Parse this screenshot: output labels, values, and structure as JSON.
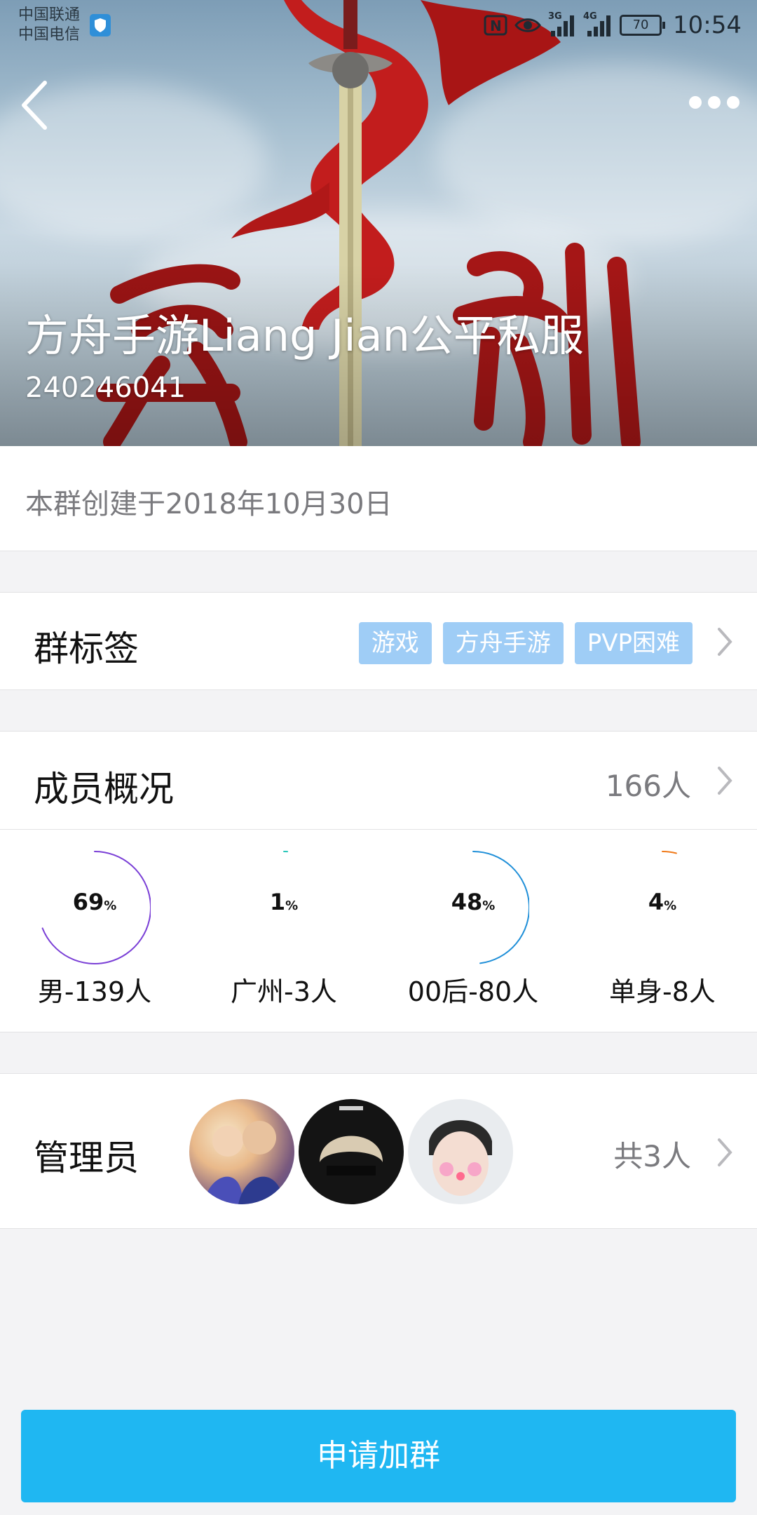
{
  "statusbar": {
    "carrier_1": "中国联通",
    "carrier_2": "中国电信",
    "signal_labels": [
      "3G",
      "4G"
    ],
    "battery": "70",
    "time": "10:54"
  },
  "header": {
    "back_icon": "chevron-left-icon",
    "more_icon": "more-dots-icon"
  },
  "group": {
    "name": "方舟手游Liang Jian公平私服",
    "id": "240246041",
    "created": "本群创建于2018年10月30日"
  },
  "tags": {
    "label": "群标签",
    "items": [
      "游戏",
      "方舟手游",
      "PVP困难"
    ]
  },
  "members": {
    "label": "成员概况",
    "count": "166人",
    "stats": [
      {
        "percent": 69,
        "label": "男-139人",
        "color": "#7a3fd6"
      },
      {
        "percent": 1,
        "label": "广州-3人",
        "color": "#27c6b8"
      },
      {
        "percent": 48,
        "label": "00后-80人",
        "color": "#1f8fd8"
      },
      {
        "percent": 4,
        "label": "单身-8人",
        "color": "#f07a1a"
      }
    ]
  },
  "admins": {
    "label": "管理员",
    "count": "共3人"
  },
  "join_button": "申请加群",
  "colors": {
    "accent": "#1fb7f2",
    "tag": "#9fcdf6"
  }
}
